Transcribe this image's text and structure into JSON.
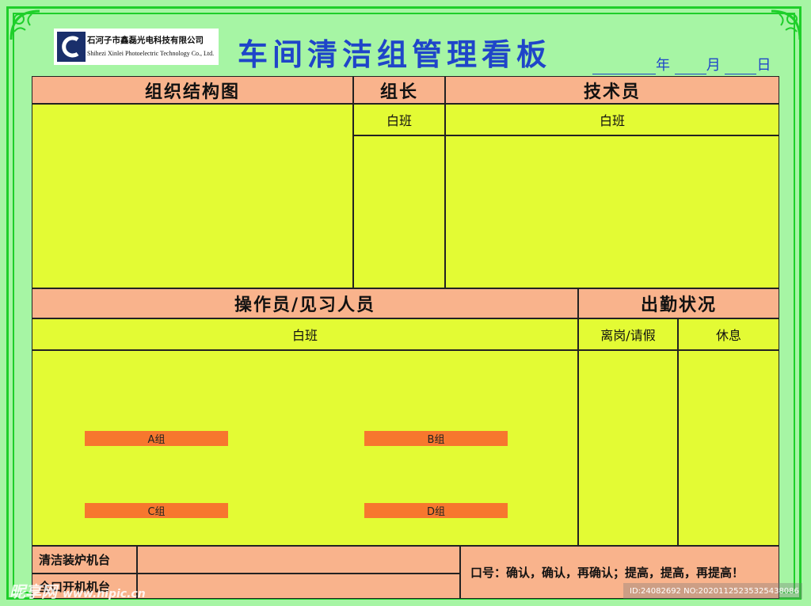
{
  "colors": {
    "background": "#a6f5a4",
    "frame": "#1ecf2a",
    "title": "#1f45c9",
    "header": "#f9b38c",
    "cell": "#e3fb34",
    "group_tag": "#f7772e"
  },
  "logo": {
    "cn": "石河子市鑫磊光电科技有限公司",
    "en": "Shihezi Xinlei Photoelectric Technology Co., Ltd."
  },
  "title": "车间清洁组管理看板",
  "date": {
    "year": "年",
    "month": "月",
    "day": "日"
  },
  "org_chart": {
    "header": "组织结构图"
  },
  "leader": {
    "header": "组长",
    "shift": "白班"
  },
  "technician": {
    "header": "技术员",
    "shift": "白班"
  },
  "operators": {
    "header": "操作员/见习人员",
    "shift": "白班",
    "groups": [
      "A组",
      "B组",
      "C组",
      "D组"
    ]
  },
  "attendance": {
    "header": "出勤状况",
    "col1": "离岗/请假",
    "col2": "休息"
  },
  "bottom": {
    "row1": "清洁装炉机台",
    "row2": "全口开机机台",
    "slogan": "口号：确认，确认，再确认；提高，提高，再提高！"
  },
  "watermark": {
    "site": "昵享网",
    "url": "www.nipic.cn",
    "id": "ID:24082692 NO:20201125235325438086"
  }
}
